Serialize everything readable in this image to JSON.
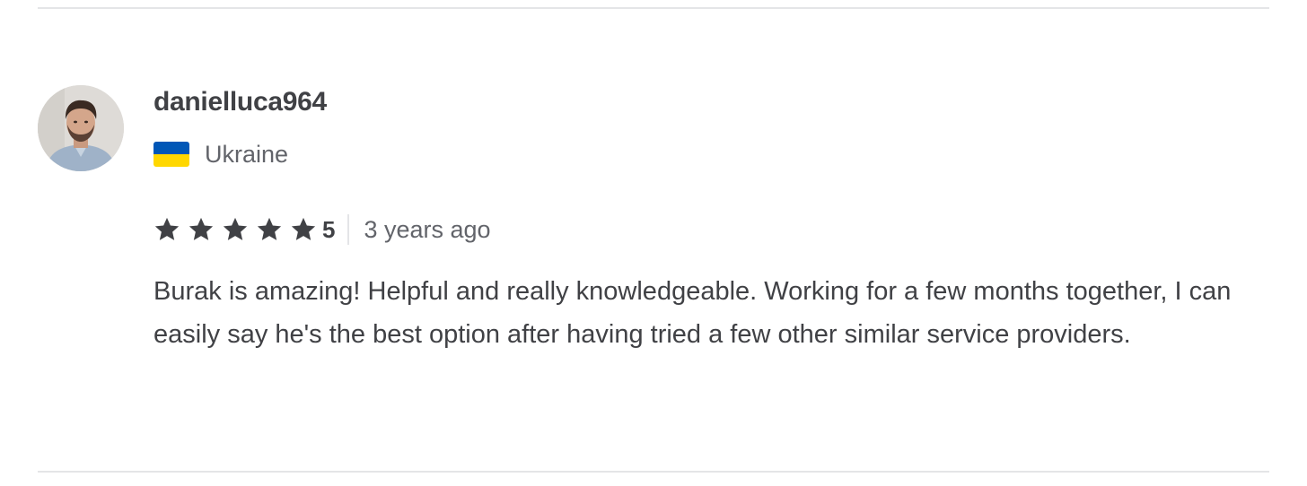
{
  "review": {
    "username": "danielluca964",
    "country": "Ukraine",
    "flag_colors": [
      "#0057b7",
      "#ffd700"
    ],
    "rating": {
      "stars": 5,
      "max_stars": 5,
      "value_label": "5"
    },
    "time_ago": "3 years ago",
    "text": "Burak is amazing! Helpful and really knowledgeable. Working for a few months together, I can easily say he's the best option after having tried a few other similar service providers."
  },
  "colors": {
    "text_primary": "#404145",
    "text_secondary": "#62646a",
    "divider": "#e4e5e7",
    "star": "#404145"
  }
}
